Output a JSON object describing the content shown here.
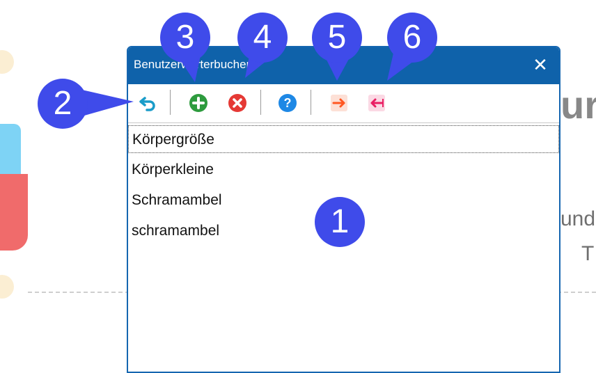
{
  "dialog": {
    "title": "Benutzerwörterbuchen",
    "close_glyph": "✕"
  },
  "toolbar": {
    "buttons": [
      {
        "icon": "undo-icon",
        "color": "#1a9cc9"
      },
      {
        "icon": "add-icon",
        "color": "#2e9b3e"
      },
      {
        "icon": "delete-icon",
        "color": "#e53935"
      },
      {
        "icon": "help-icon",
        "color": "#1e88e5"
      },
      {
        "icon": "export-icon",
        "color": "#ff5722"
      },
      {
        "icon": "import-icon",
        "color": "#e91e63"
      }
    ]
  },
  "list": {
    "items": [
      "Körpergröße",
      "Körperkleine",
      "Schramambel",
      "schramambel"
    ],
    "selected_index": 0
  },
  "callouts": [
    "1",
    "2",
    "3",
    "4",
    "5",
    "6"
  ],
  "background": {
    "text_big": "ur",
    "text_med1": "und",
    "text_med2": "T"
  },
  "colors": {
    "callout": "#3f4bea",
    "titlebar": "#0f62aa"
  }
}
